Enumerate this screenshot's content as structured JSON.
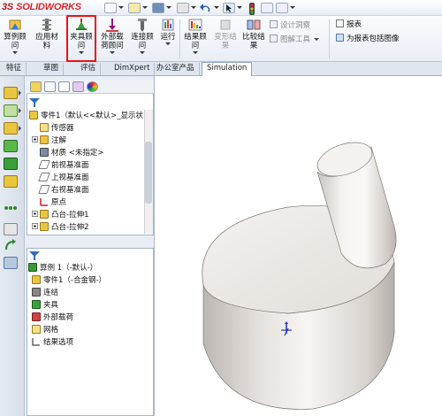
{
  "app": {
    "logo_ds": "3S",
    "logo_text": "SOLIDWORKS"
  },
  "ribbon": {
    "buttons": [
      {
        "label": "算例顾\n问"
      },
      {
        "label": "应用材\n料"
      },
      {
        "label": "夹具顾\n问"
      },
      {
        "label": "外部载\n荷顾问"
      },
      {
        "label": "连接顾\n问"
      },
      {
        "label": "运行"
      },
      {
        "label": "结果顾\n问"
      }
    ],
    "deform_label": "变形结\n果",
    "compare_label": "比较结\n果",
    "design_insight": "设计洞察",
    "plot_tools": "图解工具",
    "report": "报表",
    "include_image": "为报表包括图像"
  },
  "tabs": [
    {
      "label": "特征"
    },
    {
      "label": "草图"
    },
    {
      "label": "评估"
    },
    {
      "label": "DimXpert"
    },
    {
      "label": "办公室产品"
    },
    {
      "label": "Simulation",
      "active": true
    }
  ],
  "tree": {
    "root": "零件1（默认<<默认>_显示状",
    "items": [
      {
        "label": "传感器"
      },
      {
        "label": "注解"
      },
      {
        "label": "材质 <未指定>"
      },
      {
        "label": "前视基准面"
      },
      {
        "label": "上视基准面"
      },
      {
        "label": "右视基准面"
      },
      {
        "label": "原点"
      },
      {
        "label": "凸台-拉伸1"
      },
      {
        "label": "凸台-拉伸2"
      }
    ]
  },
  "study": {
    "root": "算例 1（-默认-）",
    "items": [
      {
        "label": "零件1（-合金钢-）"
      },
      {
        "label": "连结"
      },
      {
        "label": "夹具"
      },
      {
        "label": "外部载荷"
      },
      {
        "label": "网格"
      },
      {
        "label": "结果选项"
      }
    ]
  }
}
